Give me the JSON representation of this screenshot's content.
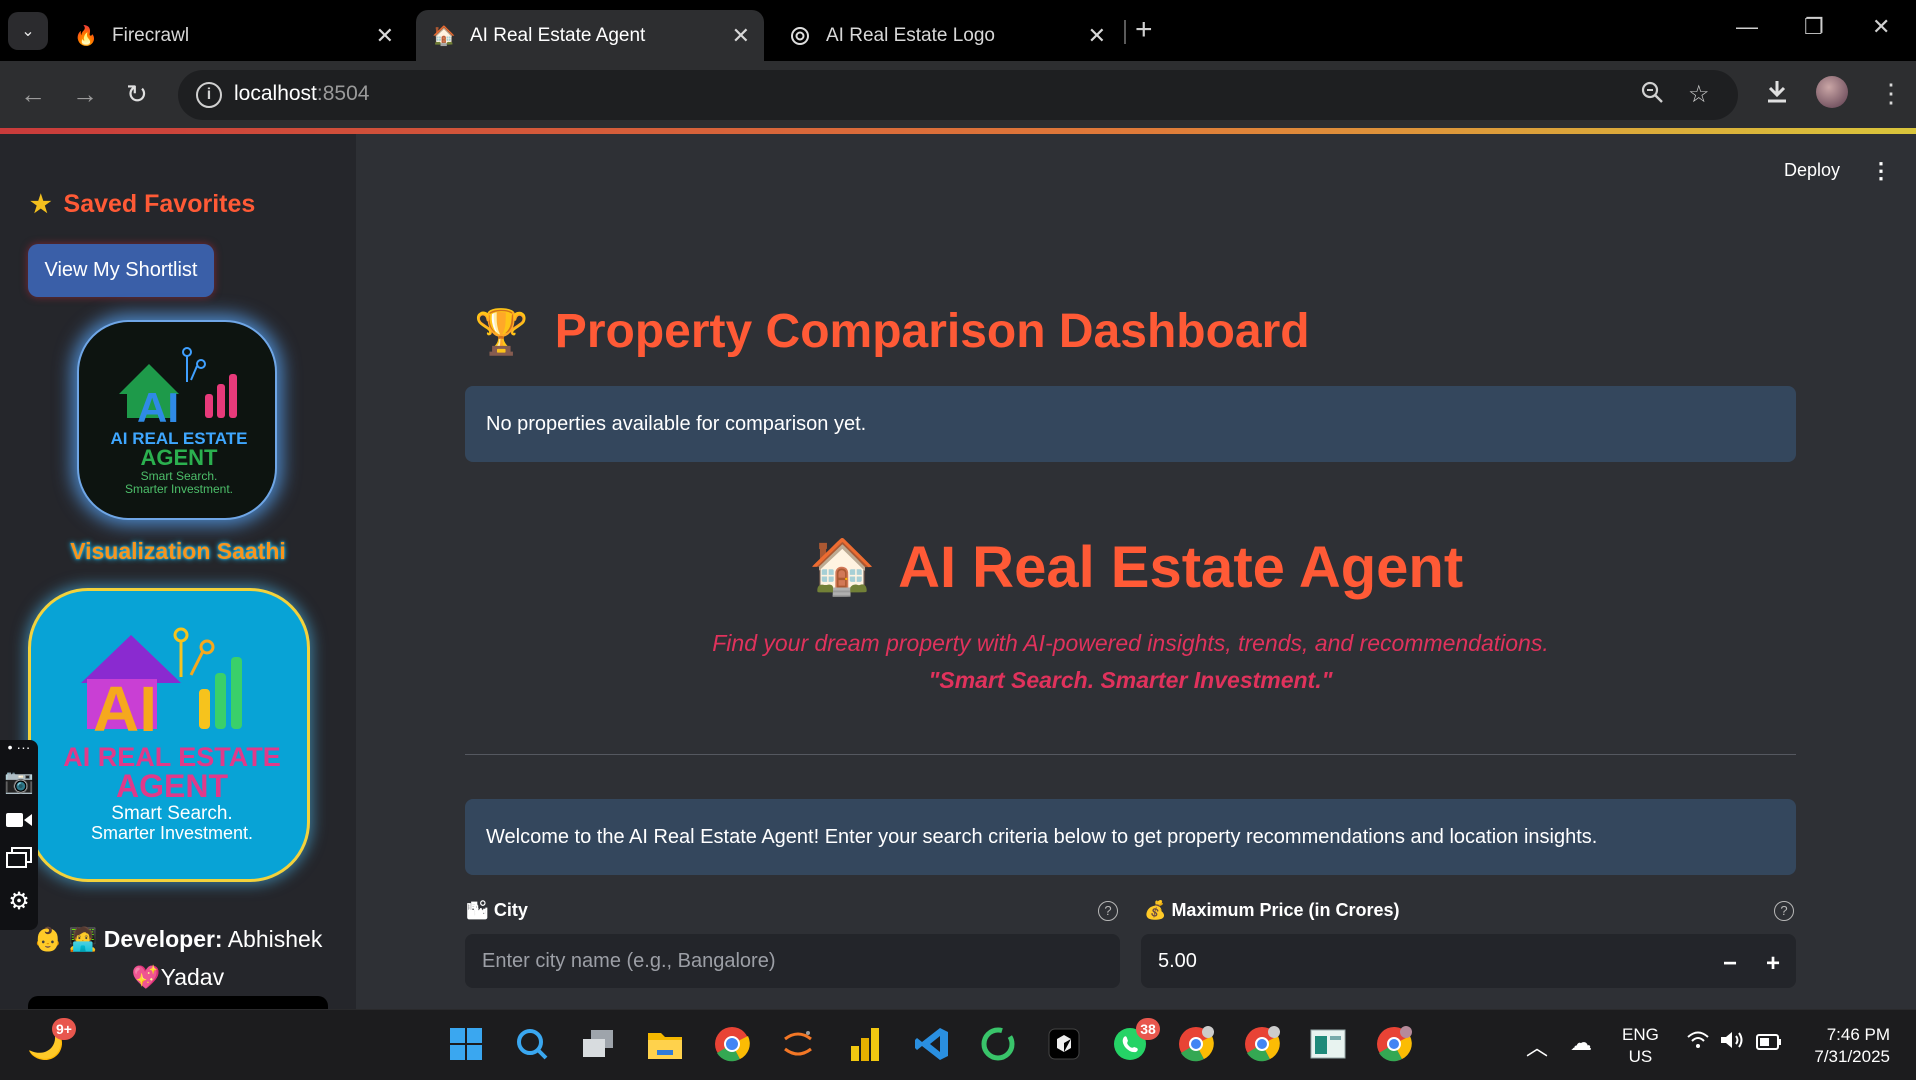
{
  "browser": {
    "tabs": [
      {
        "title": "Firecrawl",
        "icon": "fire-icon",
        "active": false
      },
      {
        "title": "AI Real Estate Agent",
        "icon": "house-icon",
        "active": true
      },
      {
        "title": "AI Real Estate Logo",
        "icon": "openai-icon",
        "active": false
      }
    ],
    "url_host": "localhost",
    "url_port": ":8504"
  },
  "sidebar": {
    "favorites_title": "Saved Favorites",
    "favorites_icon": "star-icon",
    "shortlist_button": "View My Shortlist",
    "logo1": {
      "ai": "AI",
      "line1": "AI REAL ESTATE",
      "line2": "AGENT",
      "line3": "Smart Search.",
      "line4": "Smarter Investment."
    },
    "visualization_label": "Visualization Saathi",
    "logo2": {
      "ai": "AI",
      "line1": "AI REAL ESTATE",
      "line2": "AGENT",
      "line3": "Smart Search.",
      "line4": "Smarter Investment."
    },
    "developer_label": "Developer:",
    "developer_first": "Abhishek",
    "developer_last": "Yadav"
  },
  "app": {
    "deploy_label": "Deploy",
    "comparison_title": "Property Comparison Dashboard",
    "comparison_icon": "trophy-icon",
    "comparison_empty": "No properties available for comparison yet.",
    "agent_title": "AI Real Estate Agent",
    "agent_icon": "house-icon",
    "tagline": "Find your dream property with AI-powered insights, trends, and recommendations.",
    "slogan": "\"Smart Search. Smarter Investment.\"",
    "welcome": "Welcome to the AI Real Estate Agent! Enter your search criteria below to get property recommendations and location insights.",
    "city_label": "City",
    "city_placeholder": "Enter city name (e.g., Bangalore)",
    "price_label": "Maximum Price (in Crores)",
    "price_value": "5.00"
  },
  "taskbar": {
    "weather_badge": "9+",
    "whatsapp_badge": "38",
    "lang_line1": "ENG",
    "lang_line2": "US",
    "time": "7:46 PM",
    "date": "7/31/2025"
  },
  "colors": {
    "accent": "#ff5a36",
    "tagline": "#e0325c",
    "info_bg": "#34475d",
    "button": "#3a5fa8"
  }
}
